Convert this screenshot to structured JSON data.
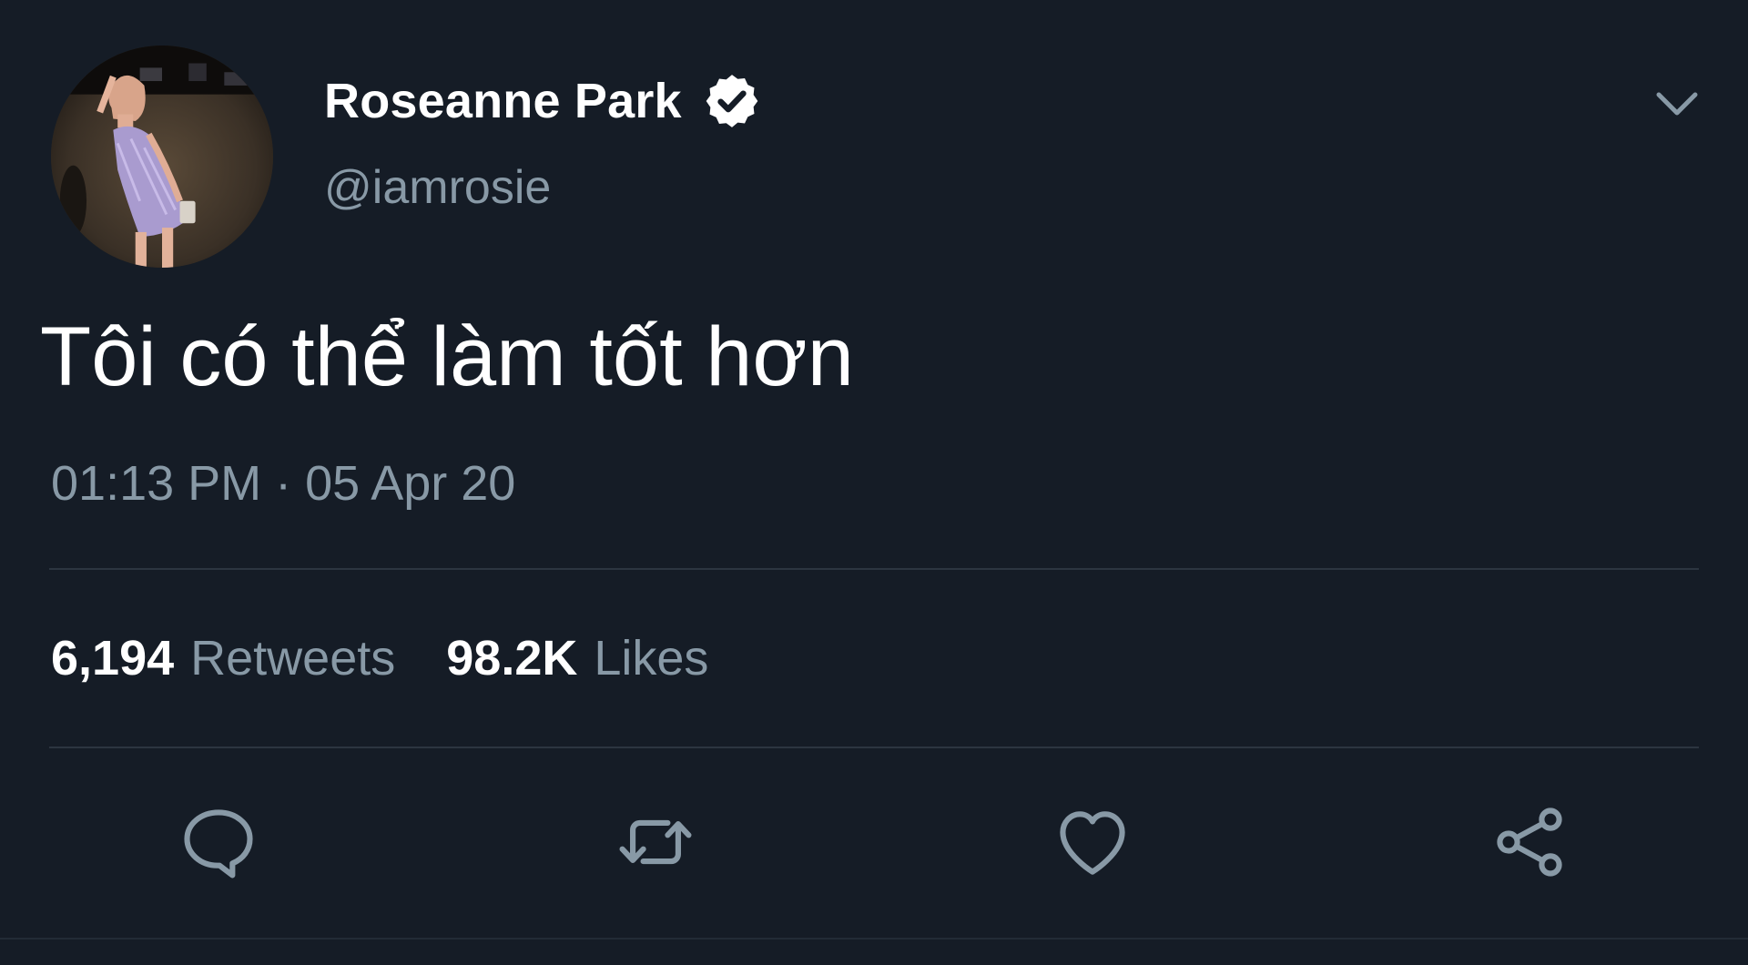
{
  "author": {
    "display_name": "Roseanne Park",
    "handle": "@iamrosie",
    "verified": true,
    "avatar": "profile-photo"
  },
  "tweet": {
    "text": "Tôi có thể làm tốt hơn",
    "timestamp": "01:13 PM · 05 Apr 20"
  },
  "stats": {
    "retweets_count": "6,194",
    "retweets_label": "Retweets",
    "likes_count": "98.2K",
    "likes_label": "Likes"
  },
  "actions": [
    {
      "name": "reply",
      "icon": "reply-icon"
    },
    {
      "name": "retweet",
      "icon": "retweet-icon"
    },
    {
      "name": "like",
      "icon": "heart-icon"
    },
    {
      "name": "share",
      "icon": "share-icon"
    }
  ],
  "colors": {
    "background": "#151c26",
    "primary_text": "#ffffff",
    "secondary_text": "#8899a6",
    "divider": "#2c3540",
    "icon": "#8899a6"
  }
}
